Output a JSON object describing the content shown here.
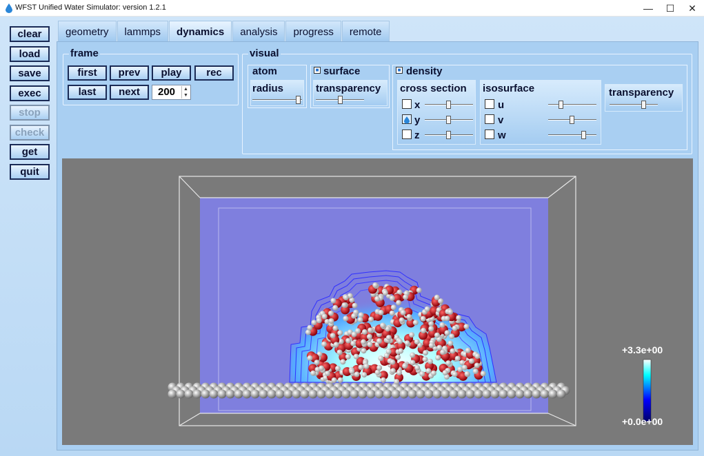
{
  "window": {
    "title": "WFST Unified Water Simulator: version 1.2.1",
    "minimize": "—",
    "maximize": "☐",
    "close": "✕"
  },
  "sidebar": {
    "buttons": [
      {
        "label": "clear",
        "enabled": true
      },
      {
        "label": "load",
        "enabled": true
      },
      {
        "label": "save",
        "enabled": true
      },
      {
        "label": "exec",
        "enabled": true
      },
      {
        "label": "stop",
        "enabled": false
      },
      {
        "label": "check",
        "enabled": false
      },
      {
        "label": "get",
        "enabled": true
      },
      {
        "label": "quit",
        "enabled": true
      }
    ]
  },
  "tabs": [
    {
      "label": "geometry",
      "active": false
    },
    {
      "label": "lammps",
      "active": false
    },
    {
      "label": "dynamics",
      "active": true
    },
    {
      "label": "analysis",
      "active": false
    },
    {
      "label": "progress",
      "active": false
    },
    {
      "label": "remote",
      "active": false
    }
  ],
  "frame": {
    "title": "frame",
    "buttons": [
      "first",
      "prev",
      "play",
      "rec",
      "last",
      "next"
    ],
    "frame_number": "200"
  },
  "visual": {
    "title": "visual",
    "atom": {
      "title": "atom",
      "radius_label": "radius",
      "radius_level": 1.0
    },
    "surface": {
      "title": "surface",
      "enabled": true,
      "transparency_label": "transparency",
      "transparency_level": 0.5
    },
    "density": {
      "title": "density",
      "enabled": true,
      "cross_section": {
        "title": "cross section",
        "axes": [
          {
            "label": "x",
            "checked": false,
            "level": 0.5
          },
          {
            "label": "y",
            "checked": true,
            "level": 0.5
          },
          {
            "label": "z",
            "checked": false,
            "level": 0.5
          }
        ]
      },
      "isosurface": {
        "title": "isosurface",
        "components": [
          {
            "label": "u",
            "checked": false,
            "level": 0.25
          },
          {
            "label": "v",
            "checked": false,
            "level": 0.5
          },
          {
            "label": "w",
            "checked": false,
            "level": 0.75
          }
        ]
      },
      "transparency": {
        "label": "transparency",
        "level": 0.7
      }
    }
  },
  "colorbar": {
    "max_label": "+3.3e+00",
    "min_label": "+0.0e+00",
    "colors": [
      "#000066",
      "#0000ff",
      "#00ffff",
      "#ffffff"
    ]
  },
  "scene": {
    "background": "#7a7a7a",
    "cross_section_color": "#7f7fde",
    "oxygen_color": "#d0101a",
    "hydrogen_color": "#f0f0f0",
    "substrate_color": "#c4c4c4",
    "contour_color": "#3030ff"
  }
}
